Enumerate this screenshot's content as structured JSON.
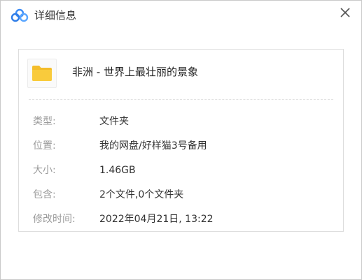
{
  "window": {
    "title": "详细信息",
    "app_icon": "cloud-logo-icon",
    "close_icon": "close-icon"
  },
  "file": {
    "icon": "folder-icon",
    "name": "非洲 - 世界上最壮丽的景象"
  },
  "details": [
    {
      "label": "类型:",
      "value": "文件夹"
    },
    {
      "label": "位置:",
      "value": "我的网盘/好样猫3号备用"
    },
    {
      "label": "大小:",
      "value": "1.46GB"
    },
    {
      "label": "包含:",
      "value": "2个文件,0个文件夹"
    },
    {
      "label": "修改时间:",
      "value": "2022年04月21日, 13:22"
    }
  ],
  "colors": {
    "logo_blue": "#3b8cf6",
    "folder_yellow": "#f9c837",
    "label_gray": "#9a9a9a",
    "value_dark": "#333333"
  }
}
